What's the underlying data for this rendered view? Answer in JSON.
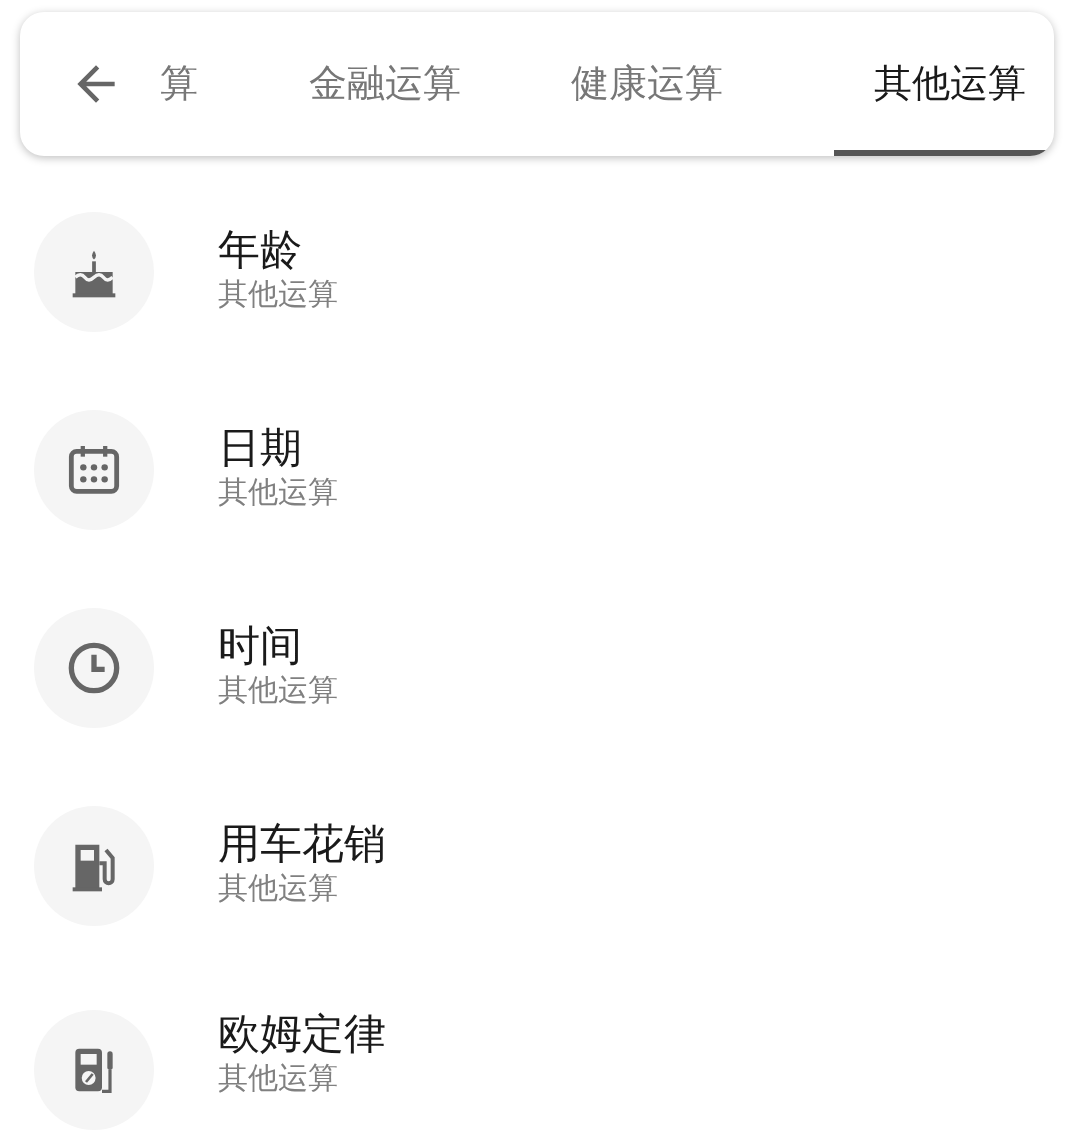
{
  "tabs": [
    {
      "label": "算",
      "selected": false
    },
    {
      "label": "金融运算",
      "selected": false
    },
    {
      "label": "健康运算",
      "selected": false
    },
    {
      "label": "其他运算",
      "selected": true
    }
  ],
  "items": [
    {
      "title": "年龄",
      "subtitle": "其他运算"
    },
    {
      "title": "日期",
      "subtitle": "其他运算"
    },
    {
      "title": "时间",
      "subtitle": "其他运算"
    },
    {
      "title": "用车花销",
      "subtitle": "其他运算"
    },
    {
      "title": "欧姆定律",
      "subtitle": "其他运算"
    }
  ]
}
